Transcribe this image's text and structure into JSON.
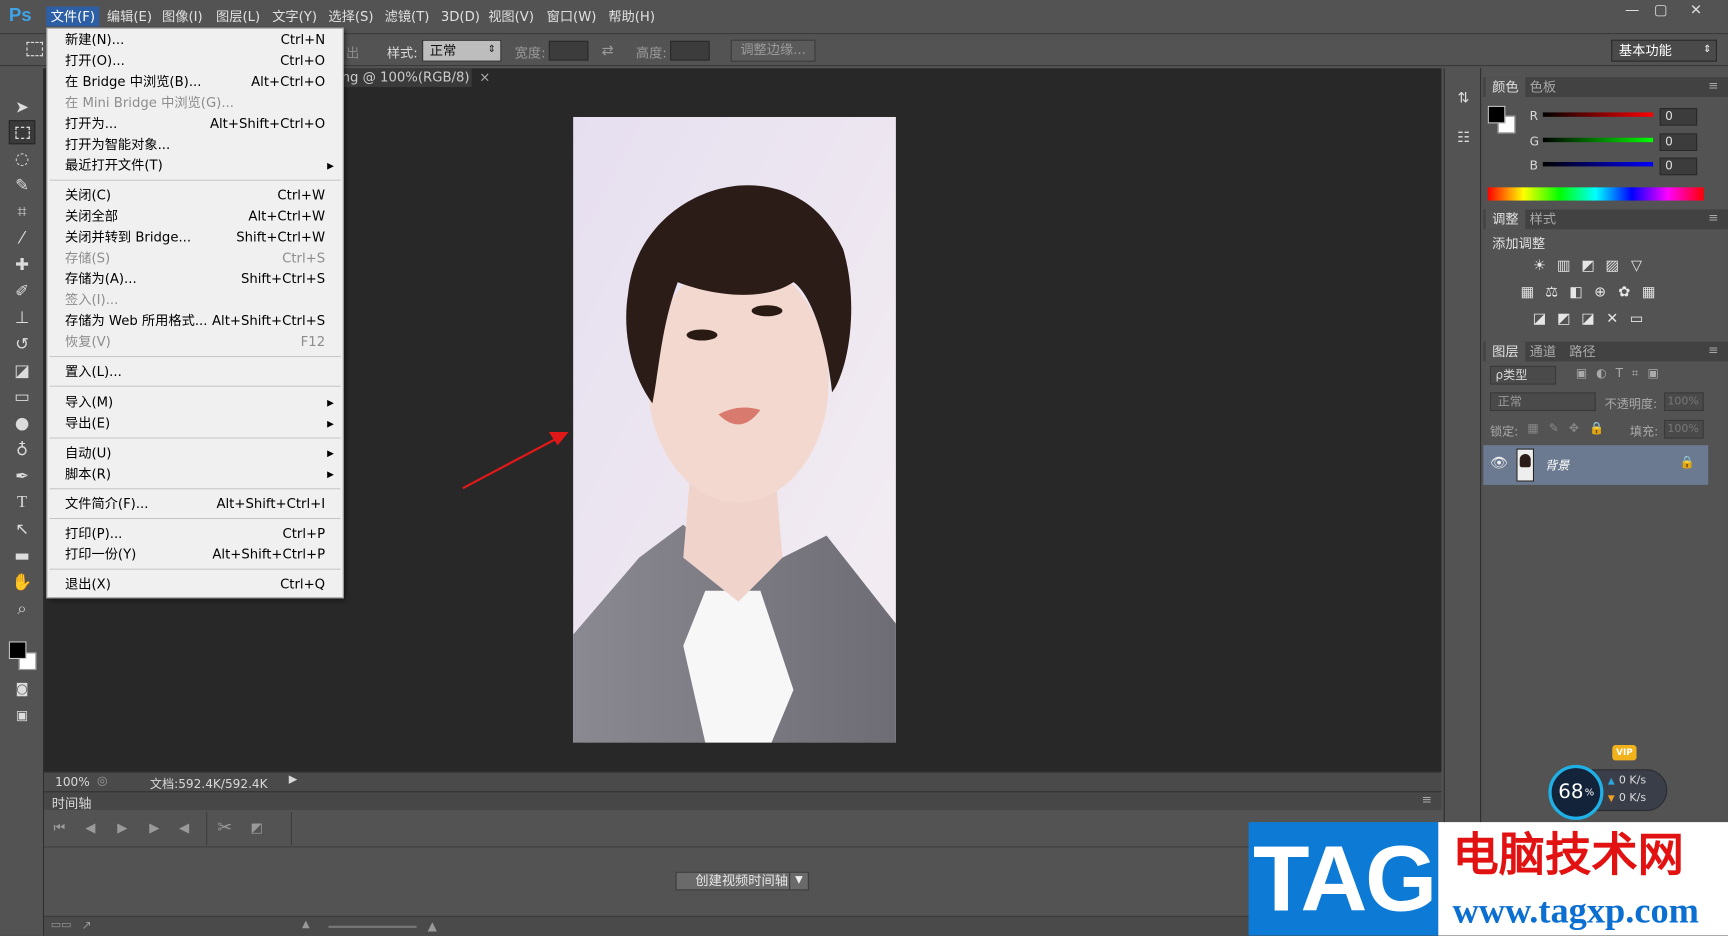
{
  "menubar": {
    "logo": "Ps",
    "items": [
      "文件(F)",
      "编辑(E)",
      "图像(I)",
      "图层(L)",
      "文字(Y)",
      "选择(S)",
      "滤镜(T)",
      "3D(D)",
      "视图(V)",
      "窗口(W)",
      "帮助(H)"
    ],
    "window_controls": [
      "—",
      "▢",
      "✕"
    ]
  },
  "options": {
    "style_label": "样式:",
    "style_value": "正常",
    "width_label": "宽度:",
    "height_label": "高度:",
    "refine_button": "调整边缘...",
    "workspace": "基本功能",
    "clipped_text": "出"
  },
  "document": {
    "tab_title": "ng @ 100%(RGB/8)",
    "tab_close": "×",
    "zoom": "100%",
    "doc_info": "文档:592.4K/592.4K"
  },
  "file_menu": {
    "items": [
      {
        "label": "新建(N)...",
        "shortcut": "Ctrl+N",
        "disabled": false
      },
      {
        "label": "打开(O)...",
        "shortcut": "Ctrl+O",
        "disabled": false
      },
      {
        "label": "在 Bridge 中浏览(B)...",
        "shortcut": "Alt+Ctrl+O",
        "disabled": false
      },
      {
        "label": "在 Mini Bridge 中浏览(G)...",
        "shortcut": "",
        "disabled": true
      },
      {
        "label": "打开为...",
        "shortcut": "Alt+Shift+Ctrl+O",
        "disabled": false
      },
      {
        "label": "打开为智能对象...",
        "shortcut": "",
        "disabled": false
      },
      {
        "label": "最近打开文件(T)",
        "shortcut": "",
        "disabled": false,
        "submenu": true
      },
      {
        "label": "关闭(C)",
        "shortcut": "Ctrl+W",
        "disabled": false
      },
      {
        "label": "关闭全部",
        "shortcut": "Alt+Ctrl+W",
        "disabled": false
      },
      {
        "label": "关闭并转到 Bridge...",
        "shortcut": "Shift+Ctrl+W",
        "disabled": false
      },
      {
        "label": "存储(S)",
        "shortcut": "Ctrl+S",
        "disabled": true
      },
      {
        "label": "存储为(A)...",
        "shortcut": "Shift+Ctrl+S",
        "disabled": false
      },
      {
        "label": "签入(I)...",
        "shortcut": "",
        "disabled": true
      },
      {
        "label": "存储为 Web 所用格式...",
        "shortcut": "Alt+Shift+Ctrl+S",
        "disabled": false
      },
      {
        "label": "恢复(V)",
        "shortcut": "F12",
        "disabled": true
      },
      {
        "label": "置入(L)...",
        "shortcut": "",
        "disabled": false
      },
      {
        "label": "导入(M)",
        "shortcut": "",
        "disabled": false,
        "submenu": true
      },
      {
        "label": "导出(E)",
        "shortcut": "",
        "disabled": false,
        "submenu": true
      },
      {
        "label": "自动(U)",
        "shortcut": "",
        "disabled": false,
        "submenu": true
      },
      {
        "label": "脚本(R)",
        "shortcut": "",
        "disabled": false,
        "submenu": true
      },
      {
        "label": "文件简介(F)...",
        "shortcut": "Alt+Shift+Ctrl+I",
        "disabled": false
      },
      {
        "label": "打印(P)...",
        "shortcut": "Ctrl+P",
        "disabled": false
      },
      {
        "label": "打印一份(Y)",
        "shortcut": "Alt+Shift+Ctrl+P",
        "disabled": false
      },
      {
        "label": "退出(X)",
        "shortcut": "Ctrl+Q",
        "disabled": false
      }
    ]
  },
  "color_panel": {
    "tabs": [
      "颜色",
      "色板"
    ],
    "channels": [
      {
        "label": "R",
        "value": "0",
        "color": "#e02020"
      },
      {
        "label": "G",
        "value": "0",
        "color": "#20c020"
      },
      {
        "label": "B",
        "value": "0",
        "color": "#2040e0"
      }
    ]
  },
  "adjust_panel": {
    "tabs": [
      "调整",
      "样式"
    ],
    "title": "添加调整",
    "icons_row1": [
      "☀",
      "▥",
      "◩",
      "▨",
      "▽"
    ],
    "icons_row2": [
      "▦",
      "⚖",
      "◧",
      "⊕",
      "✿",
      "▦"
    ],
    "icons_row3": [
      "◪",
      "◩",
      "◪",
      "✕",
      "▭"
    ]
  },
  "layers_panel": {
    "tabs": [
      "图层",
      "通道",
      "路径"
    ],
    "kind_label": "ρ类型",
    "blend_mode": "正常",
    "opacity_label": "不透明度:",
    "opacity_value": "100%",
    "lock_label": "锁定:",
    "fill_label": "填充:",
    "fill_value": "100%",
    "layer_name": "背景"
  },
  "timeline": {
    "title": "时间轴",
    "create_button": "创建视频时间轴",
    "dropdown": "▼"
  },
  "net_widget": {
    "percent": "68",
    "percent_sign": "%",
    "up": "0 K/s",
    "down": "0 K/s",
    "badge": "VIP"
  },
  "watermark": {
    "tag": "TAG",
    "name": "电脑技术网",
    "url": "www.tagxp.com"
  }
}
